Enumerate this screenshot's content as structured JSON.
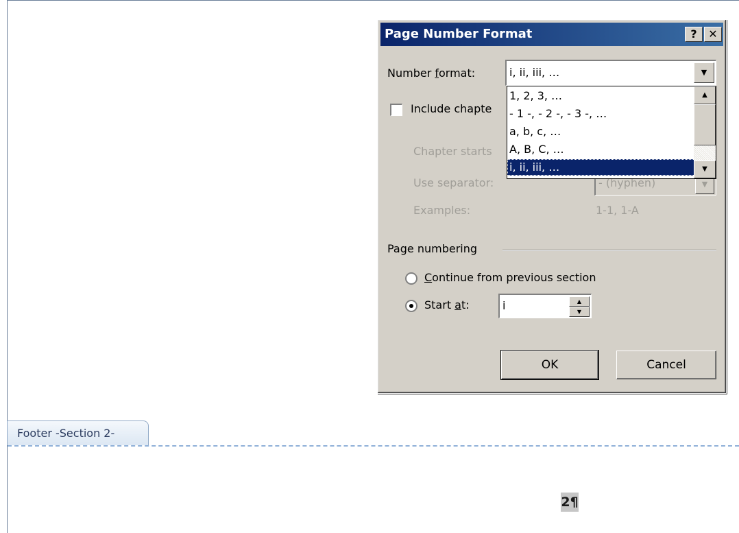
{
  "footer": {
    "tab_label": "Footer -Section 2-",
    "page_number": "2¶"
  },
  "dialog": {
    "title": "Page Number Format",
    "help_button": "?",
    "close_button": "✕",
    "number_format": {
      "label_pre": "Number ",
      "label_accel": "f",
      "label_post": "ormat:",
      "value": "i, ii, iii, …",
      "options": [
        "1, 2, 3, …",
        "- 1 -, - 2 -, - 3 -, …",
        "a, b, c, …",
        "A, B, C, …",
        "i, ii, iii, …"
      ],
      "selected_index": 4
    },
    "include_chapter_label": "Include chapte",
    "chapter_starts_label": "Chapter starts",
    "use_separator_label": "Use separator:",
    "separator_value": "-  (hyphen)",
    "examples_label": "Examples:",
    "examples_value": "1-1, 1-A",
    "page_numbering": {
      "group_label": "Page numbering",
      "continue_accel": "C",
      "continue_rest": "ontinue from previous section",
      "start_pre": "Start ",
      "start_accel": "a",
      "start_post": "t:",
      "start_value": "i"
    },
    "ok_label": "OK",
    "cancel_label": "Cancel"
  }
}
